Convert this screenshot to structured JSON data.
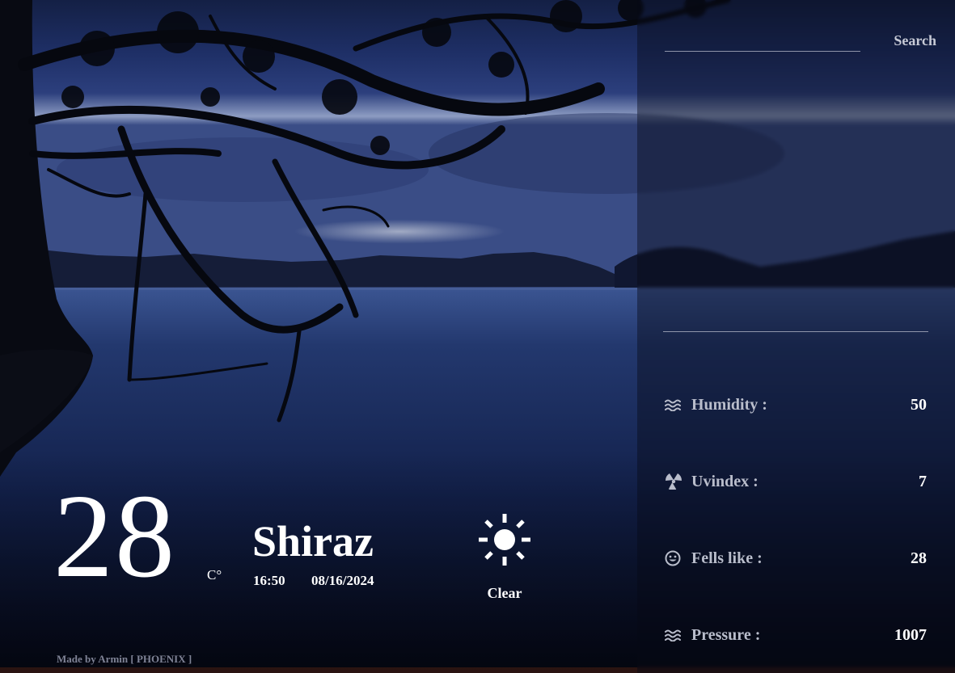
{
  "search": {
    "placeholder": "",
    "value": "",
    "button_label": "Search"
  },
  "current": {
    "temperature": "28",
    "unit": "C°",
    "city": "Shiraz",
    "time": "16:50",
    "date": "08/16/2024",
    "condition": "Clear",
    "condition_icon": "sun-icon"
  },
  "details": [
    {
      "icon": "waves-icon",
      "label": "Humidity :",
      "value": "50"
    },
    {
      "icon": "radiation-icon",
      "label": "Uvindex :",
      "value": "7"
    },
    {
      "icon": "smiley-icon",
      "label": "Fells like :",
      "value": "28"
    },
    {
      "icon": "waves-icon",
      "label": "Pressure :",
      "value": "1007"
    }
  ],
  "footer": {
    "credit": "Made by Armin [ PHOENIX ]"
  },
  "colors": {
    "text": "#ffffff",
    "label": "#b9bdcb",
    "panel": "#080a16",
    "sky_top": "#1c2a5c",
    "water": "#0d1636"
  }
}
